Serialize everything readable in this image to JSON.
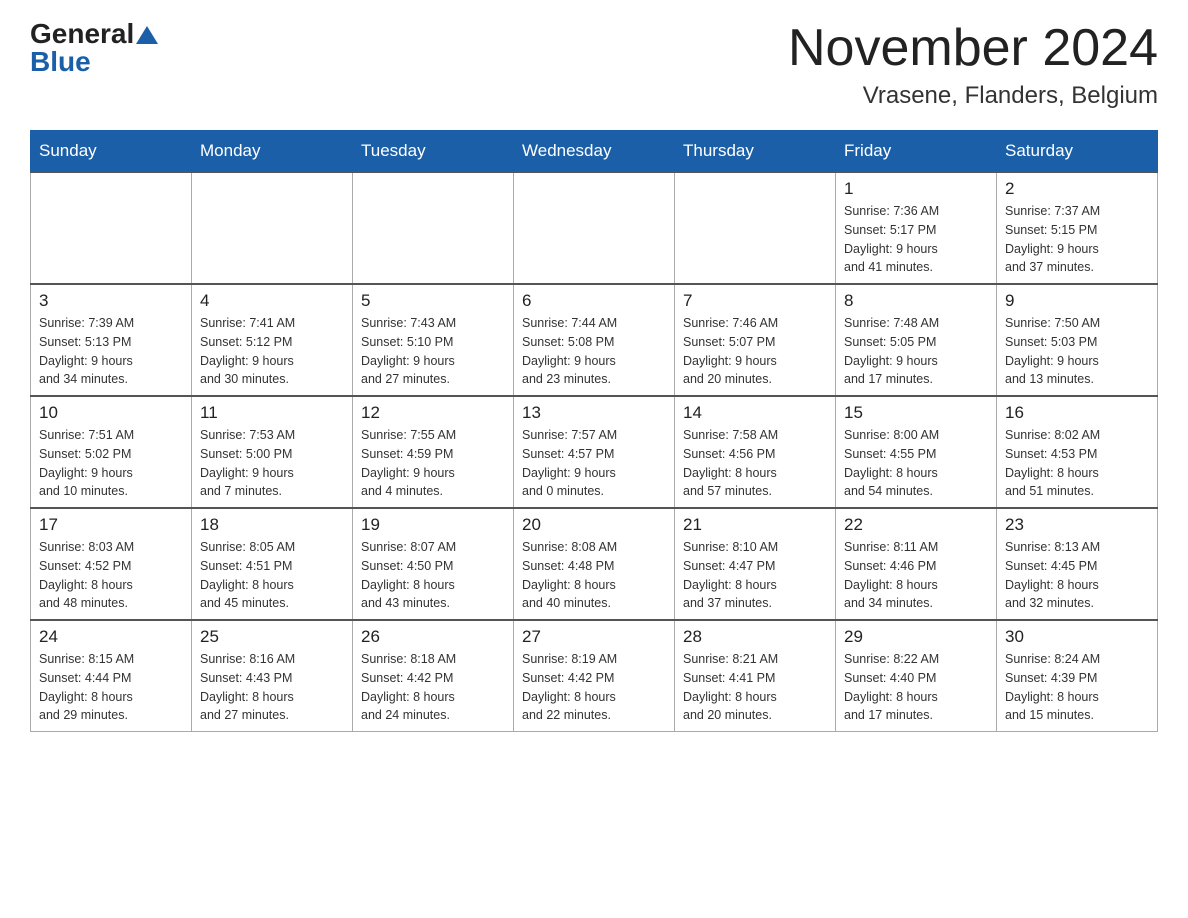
{
  "header": {
    "logo": {
      "general": "General",
      "blue": "Blue",
      "triangle": "▲"
    },
    "title": "November 2024",
    "location": "Vrasene, Flanders, Belgium"
  },
  "days_of_week": [
    "Sunday",
    "Monday",
    "Tuesday",
    "Wednesday",
    "Thursday",
    "Friday",
    "Saturday"
  ],
  "weeks": [
    [
      {
        "day": "",
        "info": ""
      },
      {
        "day": "",
        "info": ""
      },
      {
        "day": "",
        "info": ""
      },
      {
        "day": "",
        "info": ""
      },
      {
        "day": "",
        "info": ""
      },
      {
        "day": "1",
        "info": "Sunrise: 7:36 AM\nSunset: 5:17 PM\nDaylight: 9 hours\nand 41 minutes."
      },
      {
        "day": "2",
        "info": "Sunrise: 7:37 AM\nSunset: 5:15 PM\nDaylight: 9 hours\nand 37 minutes."
      }
    ],
    [
      {
        "day": "3",
        "info": "Sunrise: 7:39 AM\nSunset: 5:13 PM\nDaylight: 9 hours\nand 34 minutes."
      },
      {
        "day": "4",
        "info": "Sunrise: 7:41 AM\nSunset: 5:12 PM\nDaylight: 9 hours\nand 30 minutes."
      },
      {
        "day": "5",
        "info": "Sunrise: 7:43 AM\nSunset: 5:10 PM\nDaylight: 9 hours\nand 27 minutes."
      },
      {
        "day": "6",
        "info": "Sunrise: 7:44 AM\nSunset: 5:08 PM\nDaylight: 9 hours\nand 23 minutes."
      },
      {
        "day": "7",
        "info": "Sunrise: 7:46 AM\nSunset: 5:07 PM\nDaylight: 9 hours\nand 20 minutes."
      },
      {
        "day": "8",
        "info": "Sunrise: 7:48 AM\nSunset: 5:05 PM\nDaylight: 9 hours\nand 17 minutes."
      },
      {
        "day": "9",
        "info": "Sunrise: 7:50 AM\nSunset: 5:03 PM\nDaylight: 9 hours\nand 13 minutes."
      }
    ],
    [
      {
        "day": "10",
        "info": "Sunrise: 7:51 AM\nSunset: 5:02 PM\nDaylight: 9 hours\nand 10 minutes."
      },
      {
        "day": "11",
        "info": "Sunrise: 7:53 AM\nSunset: 5:00 PM\nDaylight: 9 hours\nand 7 minutes."
      },
      {
        "day": "12",
        "info": "Sunrise: 7:55 AM\nSunset: 4:59 PM\nDaylight: 9 hours\nand 4 minutes."
      },
      {
        "day": "13",
        "info": "Sunrise: 7:57 AM\nSunset: 4:57 PM\nDaylight: 9 hours\nand 0 minutes."
      },
      {
        "day": "14",
        "info": "Sunrise: 7:58 AM\nSunset: 4:56 PM\nDaylight: 8 hours\nand 57 minutes."
      },
      {
        "day": "15",
        "info": "Sunrise: 8:00 AM\nSunset: 4:55 PM\nDaylight: 8 hours\nand 54 minutes."
      },
      {
        "day": "16",
        "info": "Sunrise: 8:02 AM\nSunset: 4:53 PM\nDaylight: 8 hours\nand 51 minutes."
      }
    ],
    [
      {
        "day": "17",
        "info": "Sunrise: 8:03 AM\nSunset: 4:52 PM\nDaylight: 8 hours\nand 48 minutes."
      },
      {
        "day": "18",
        "info": "Sunrise: 8:05 AM\nSunset: 4:51 PM\nDaylight: 8 hours\nand 45 minutes."
      },
      {
        "day": "19",
        "info": "Sunrise: 8:07 AM\nSunset: 4:50 PM\nDaylight: 8 hours\nand 43 minutes."
      },
      {
        "day": "20",
        "info": "Sunrise: 8:08 AM\nSunset: 4:48 PM\nDaylight: 8 hours\nand 40 minutes."
      },
      {
        "day": "21",
        "info": "Sunrise: 8:10 AM\nSunset: 4:47 PM\nDaylight: 8 hours\nand 37 minutes."
      },
      {
        "day": "22",
        "info": "Sunrise: 8:11 AM\nSunset: 4:46 PM\nDaylight: 8 hours\nand 34 minutes."
      },
      {
        "day": "23",
        "info": "Sunrise: 8:13 AM\nSunset: 4:45 PM\nDaylight: 8 hours\nand 32 minutes."
      }
    ],
    [
      {
        "day": "24",
        "info": "Sunrise: 8:15 AM\nSunset: 4:44 PM\nDaylight: 8 hours\nand 29 minutes."
      },
      {
        "day": "25",
        "info": "Sunrise: 8:16 AM\nSunset: 4:43 PM\nDaylight: 8 hours\nand 27 minutes."
      },
      {
        "day": "26",
        "info": "Sunrise: 8:18 AM\nSunset: 4:42 PM\nDaylight: 8 hours\nand 24 minutes."
      },
      {
        "day": "27",
        "info": "Sunrise: 8:19 AM\nSunset: 4:42 PM\nDaylight: 8 hours\nand 22 minutes."
      },
      {
        "day": "28",
        "info": "Sunrise: 8:21 AM\nSunset: 4:41 PM\nDaylight: 8 hours\nand 20 minutes."
      },
      {
        "day": "29",
        "info": "Sunrise: 8:22 AM\nSunset: 4:40 PM\nDaylight: 8 hours\nand 17 minutes."
      },
      {
        "day": "30",
        "info": "Sunrise: 8:24 AM\nSunset: 4:39 PM\nDaylight: 8 hours\nand 15 minutes."
      }
    ]
  ]
}
